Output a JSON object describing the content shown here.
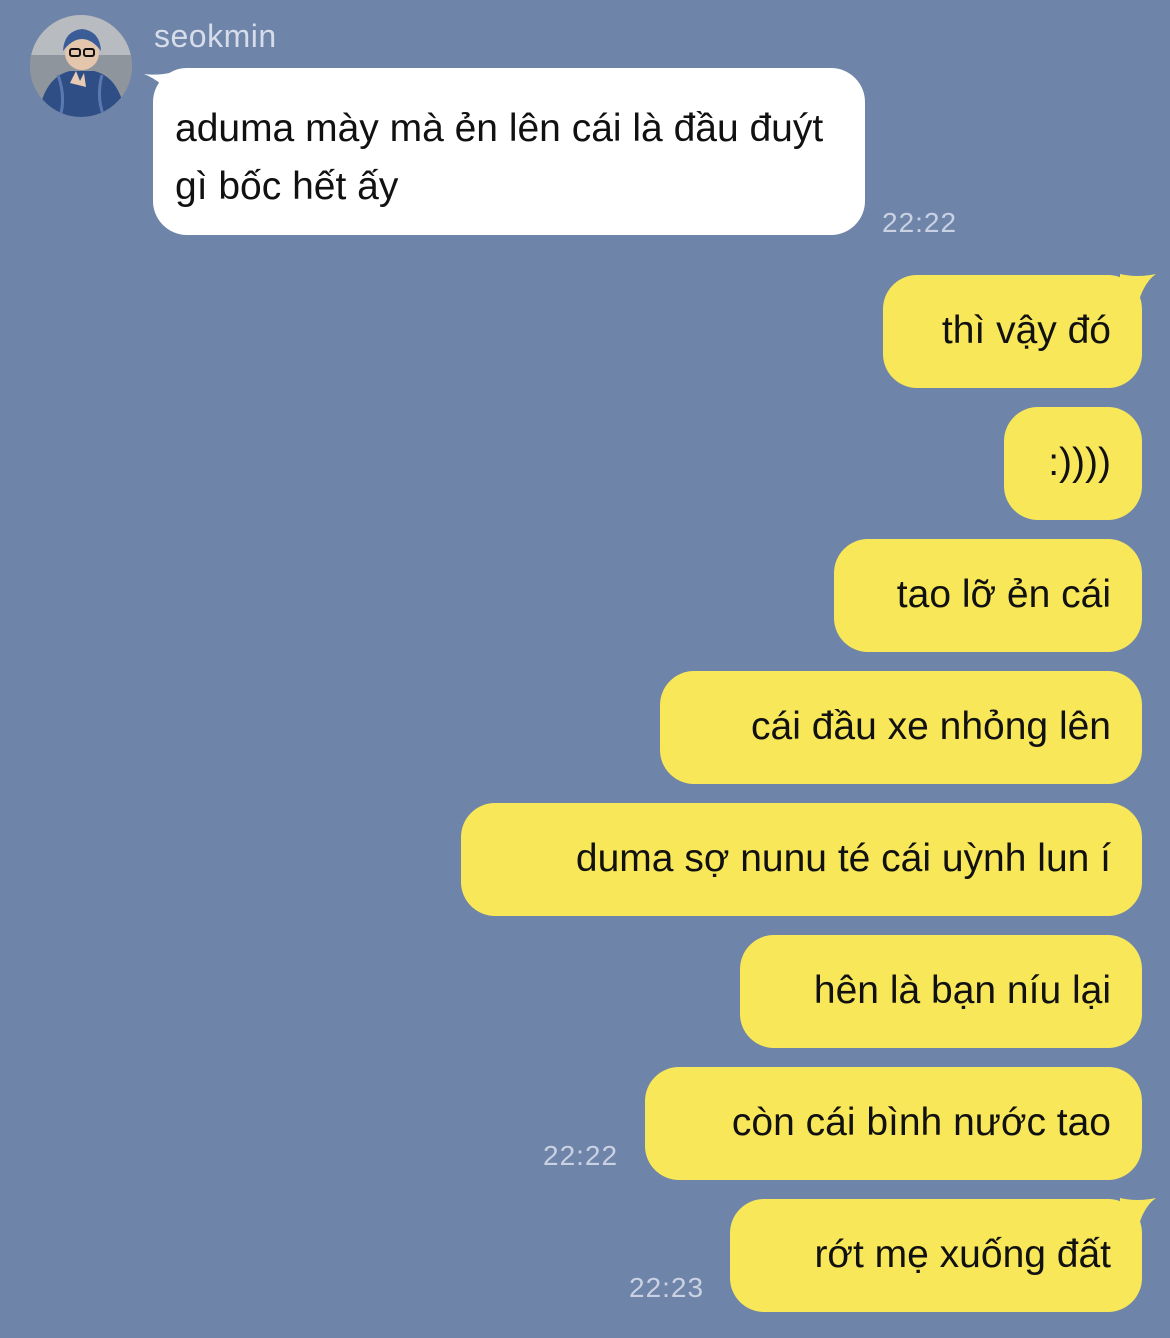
{
  "contact": {
    "name": "seokmin"
  },
  "incoming": [
    {
      "text": "aduma mày mà ẻn lên cái là đầu đuýt gì bốc hết ấy",
      "time": "22:22"
    }
  ],
  "outgoing": [
    {
      "text": "thì vậy đó"
    },
    {
      "text": ":))))"
    },
    {
      "text": "tao lỡ ẻn cái"
    },
    {
      "text": "cái đầu xe nhỏng lên"
    },
    {
      "text": "duma sợ nunu té cái uỳnh lun í"
    },
    {
      "text": "hên là bạn níu lại"
    },
    {
      "text": "còn cái bình nước tao"
    },
    {
      "text": "rớt mẹ xuống đất"
    }
  ],
  "outgoing_times": [
    {
      "time": "22:22"
    },
    {
      "time": "22:23"
    }
  ],
  "colors": {
    "background": "#6e84a8",
    "incoming_bubble": "#ffffff",
    "outgoing_bubble": "#f8e758",
    "meta_text": "#c9d1e3"
  }
}
